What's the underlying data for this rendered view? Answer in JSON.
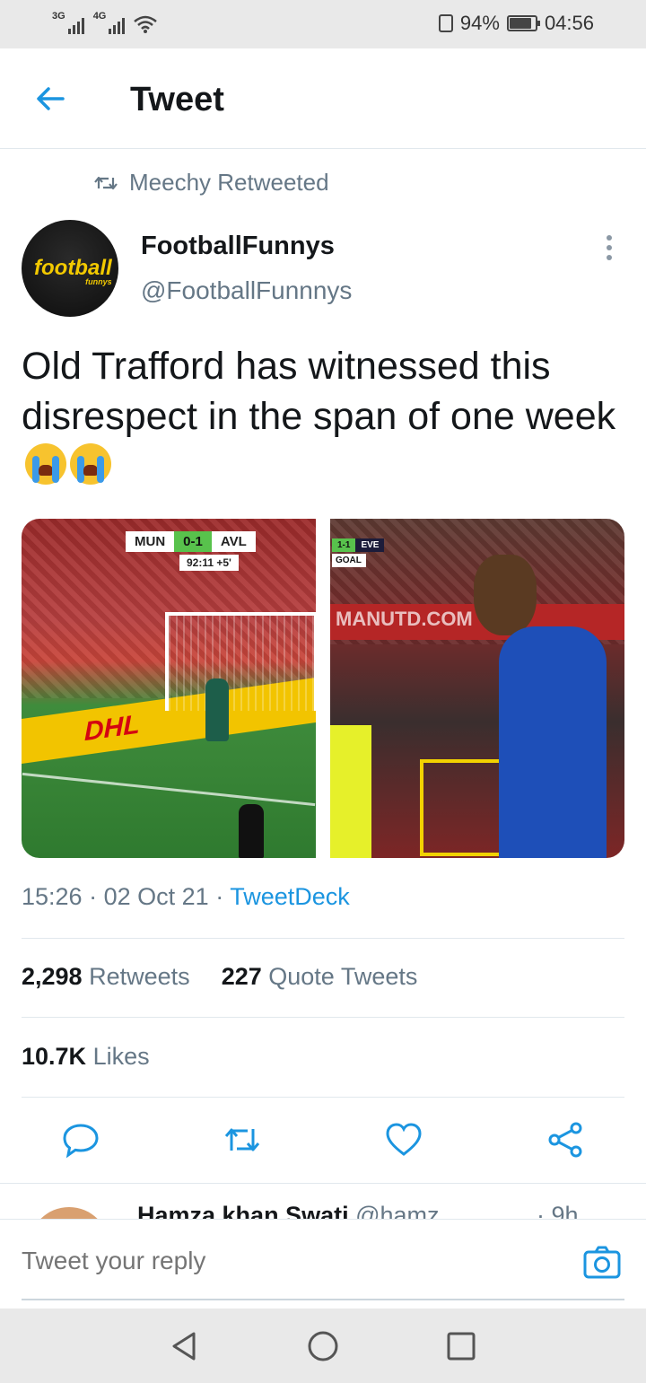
{
  "status_bar": {
    "sig1_label": "3G",
    "sig2_label": "4G",
    "battery_percent": "94%",
    "battery_level": 0.94,
    "time": "04:56"
  },
  "header": {
    "title": "Tweet",
    "back_icon": "arrow-left-icon"
  },
  "tweet": {
    "retweeted_by": "Meechy Retweeted",
    "author_name": "FootballFunnys",
    "author_handle": "@FootballFunnnys",
    "avatar_logo": "football",
    "avatar_sub": "funnys",
    "text": "Old Trafford has witnessed this disrespect in the span of one week",
    "emoji": [
      "loudly-crying-face",
      "loudly-crying-face"
    ],
    "media": [
      {
        "score_home": "MUN",
        "score": "0-1",
        "score_away": "AVL",
        "clock": "92:11",
        "added": "+5'",
        "board": "DHL"
      },
      {
        "score": "1-1",
        "team": "EVE",
        "event": "GOAL",
        "board": "MANUTD.COM"
      }
    ],
    "time": "15:26",
    "date": "02 Oct 21",
    "source": "TweetDeck",
    "retweets_count": "2,298",
    "retweets_label": "Retweets",
    "quotes_count": "227",
    "quotes_label": "Quote Tweets",
    "likes_count": "10.7K",
    "likes_label": "Likes"
  },
  "actions": {
    "reply_icon": "reply-icon",
    "retweet_icon": "retweet-icon",
    "like_icon": "heart-icon",
    "share_icon": "share-icon"
  },
  "next_reply": {
    "name": "Hamza khan Swati",
    "handle": "@hamz",
    "time": "· 9h"
  },
  "reply_bar": {
    "placeholder": "Tweet your reply",
    "camera_icon": "camera-icon"
  },
  "nav": {
    "back_icon": "nav-back-icon",
    "home_icon": "nav-home-icon",
    "recents_icon": "nav-recents-icon"
  },
  "colors": {
    "accent": "#1b95e0",
    "secondary_text": "#657786",
    "primary_text": "#14171a"
  }
}
